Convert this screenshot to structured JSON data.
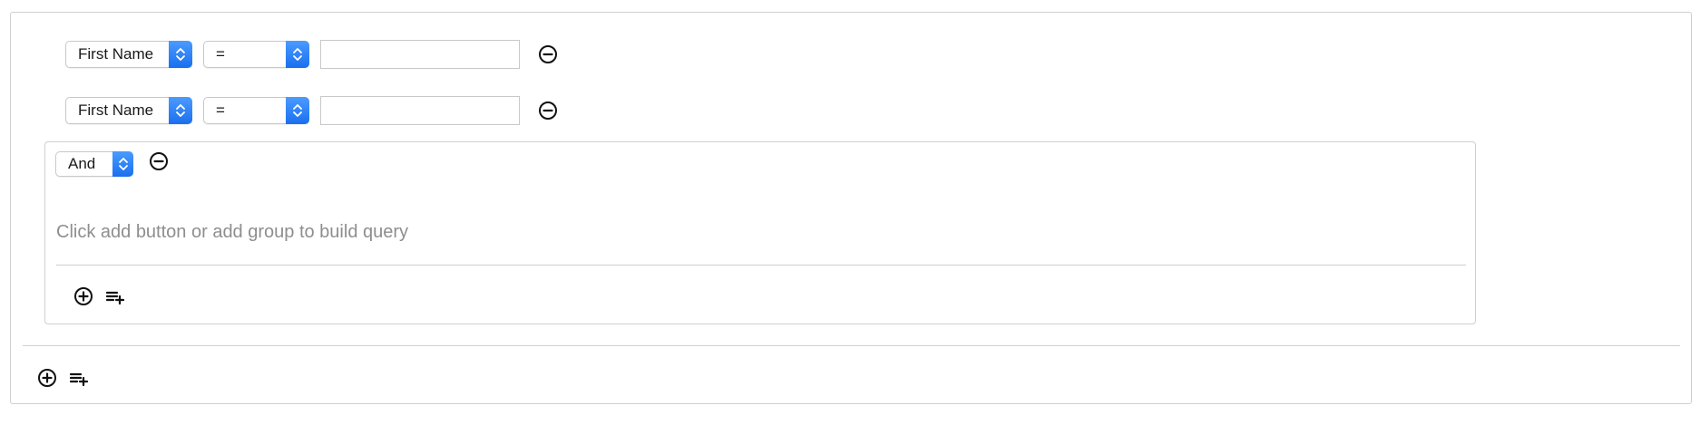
{
  "rules": [
    {
      "field": "First Name",
      "operator": "=",
      "value": ""
    },
    {
      "field": "First Name",
      "operator": "=",
      "value": ""
    }
  ],
  "group": {
    "combinator": "And",
    "empty_message": "Click add button or add group to build query"
  },
  "icons": {
    "remove": "minus-circle-icon",
    "add": "plus-circle-icon",
    "add_group": "playlist-add-icon",
    "select_arrows": "chevron-up-down-icon"
  },
  "colors": {
    "accent": "#1a6fef",
    "border": "#cfcfcf",
    "placeholder": "#8e8e8e"
  }
}
